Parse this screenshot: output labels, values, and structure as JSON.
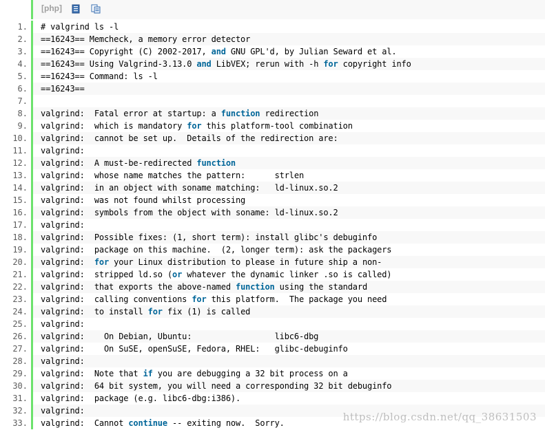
{
  "toolbar": {
    "language": "[php]",
    "icons": [
      "view-source-icon",
      "copy-icon"
    ]
  },
  "colors": {
    "gutter_bar": "#6ce26c",
    "keyword": "#006699",
    "line_number": "#5c5c5c",
    "alt_row": "#f8f8f8"
  },
  "keywords": [
    "and",
    "for",
    "function",
    "or",
    "if",
    "continue"
  ],
  "lines": [
    {
      "n": "1.",
      "text": "# valgrind ls -l"
    },
    {
      "n": "2.",
      "text": "==16243== Memcheck, a memory error detector"
    },
    {
      "n": "3.",
      "text": "==16243== Copyright (C) 2002-2017, and GNU GPL'd, by Julian Seward et al."
    },
    {
      "n": "4.",
      "text": "==16243== Using Valgrind-3.13.0 and LibVEX; rerun with -h for copyright info"
    },
    {
      "n": "5.",
      "text": "==16243== Command: ls -l"
    },
    {
      "n": "6.",
      "text": "==16243=="
    },
    {
      "n": "7.",
      "text": ""
    },
    {
      "n": "8.",
      "text": "valgrind:  Fatal error at startup: a function redirection"
    },
    {
      "n": "9.",
      "text": "valgrind:  which is mandatory for this platform-tool combination"
    },
    {
      "n": "10.",
      "text": "valgrind:  cannot be set up.  Details of the redirection are:"
    },
    {
      "n": "11.",
      "text": "valgrind:"
    },
    {
      "n": "12.",
      "text": "valgrind:  A must-be-redirected function"
    },
    {
      "n": "13.",
      "text": "valgrind:  whose name matches the pattern:      strlen"
    },
    {
      "n": "14.",
      "text": "valgrind:  in an object with soname matching:   ld-linux.so.2"
    },
    {
      "n": "15.",
      "text": "valgrind:  was not found whilst processing"
    },
    {
      "n": "16.",
      "text": "valgrind:  symbols from the object with soname: ld-linux.so.2"
    },
    {
      "n": "17.",
      "text": "valgrind:"
    },
    {
      "n": "18.",
      "text": "valgrind:  Possible fixes: (1, short term): install glibc's debuginfo"
    },
    {
      "n": "19.",
      "text": "valgrind:  package on this machine.  (2, longer term): ask the packagers"
    },
    {
      "n": "20.",
      "text": "valgrind:  for your Linux distribution to please in future ship a non-"
    },
    {
      "n": "21.",
      "text": "valgrind:  stripped ld.so (or whatever the dynamic linker .so is called)"
    },
    {
      "n": "22.",
      "text": "valgrind:  that exports the above-named function using the standard"
    },
    {
      "n": "23.",
      "text": "valgrind:  calling conventions for this platform.  The package you need"
    },
    {
      "n": "24.",
      "text": "valgrind:  to install for fix (1) is called"
    },
    {
      "n": "25.",
      "text": "valgrind:"
    },
    {
      "n": "26.",
      "text": "valgrind:    On Debian, Ubuntu:                 libc6-dbg"
    },
    {
      "n": "27.",
      "text": "valgrind:    On SuSE, openSuSE, Fedora, RHEL:   glibc-debuginfo"
    },
    {
      "n": "28.",
      "text": "valgrind:"
    },
    {
      "n": "29.",
      "text": "valgrind:  Note that if you are debugging a 32 bit process on a"
    },
    {
      "n": "30.",
      "text": "valgrind:  64 bit system, you will need a corresponding 32 bit debuginfo"
    },
    {
      "n": "31.",
      "text": "valgrind:  package (e.g. libc6-dbg:i386)."
    },
    {
      "n": "32.",
      "text": "valgrind:"
    },
    {
      "n": "33.",
      "text": "valgrind:  Cannot continue -- exiting now.  Sorry."
    }
  ],
  "watermark": "https://blog.csdn.net/qq_38631503"
}
